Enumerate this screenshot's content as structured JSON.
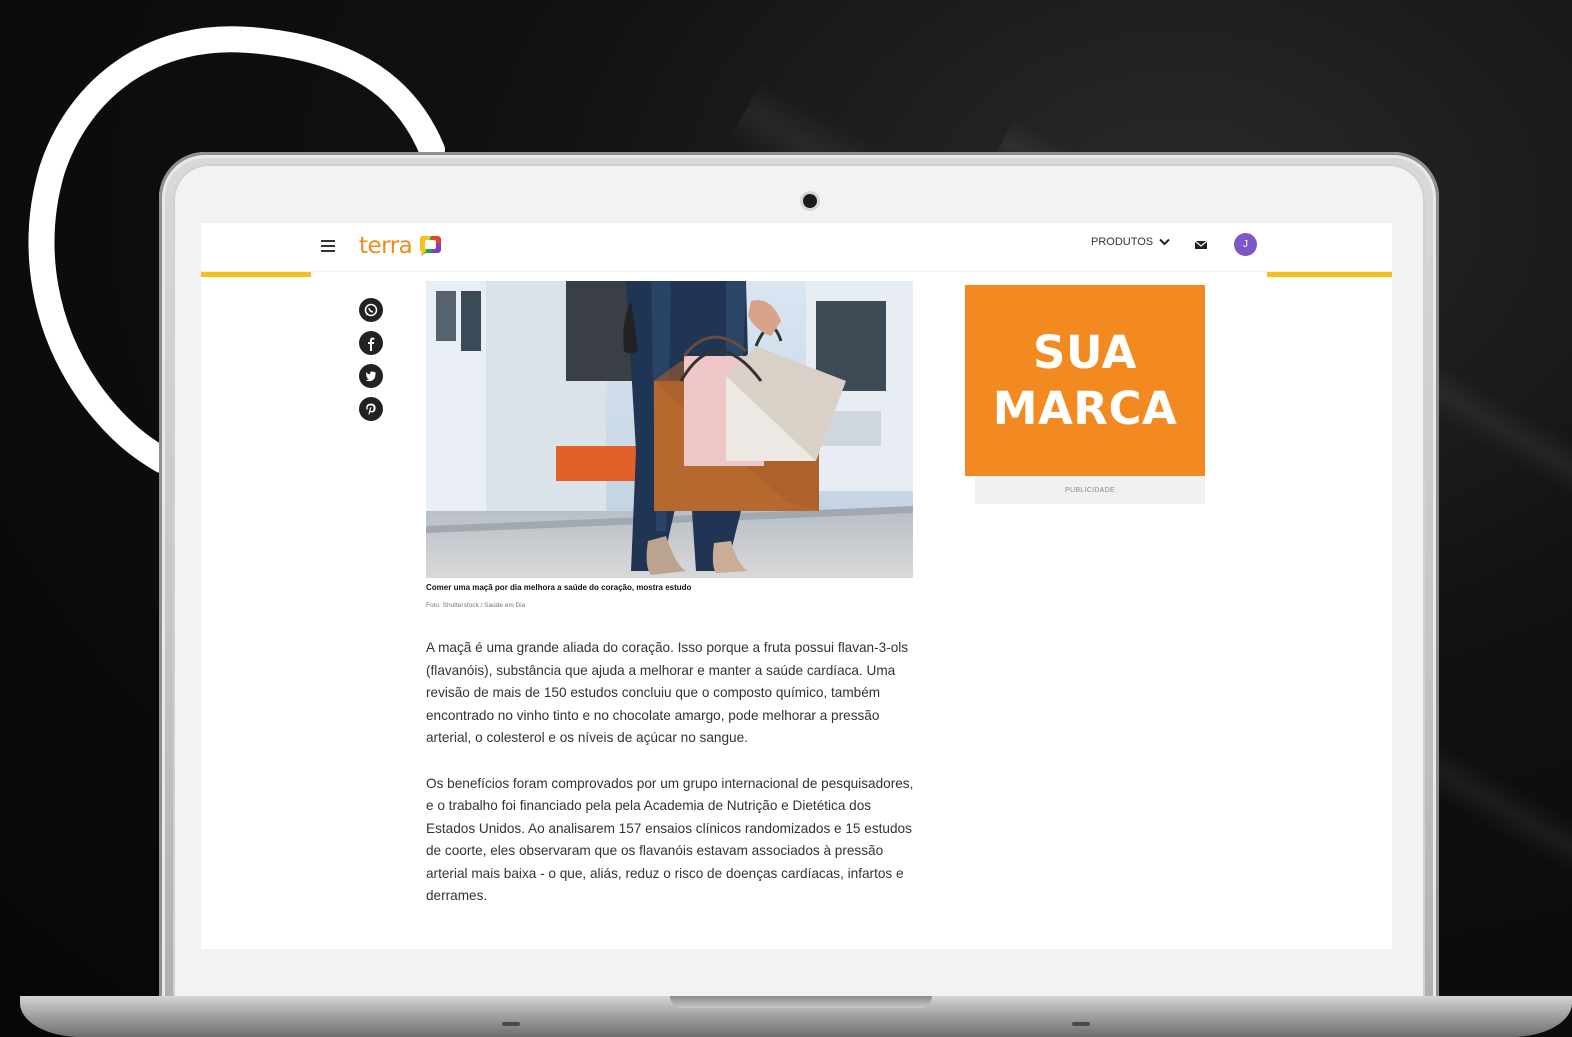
{
  "site": {
    "logo_text": "terra",
    "nav_products": "PRODUTOS",
    "user_initial": "J"
  },
  "icons": {
    "menu": "hamburger-icon",
    "products_toggle": "chevron-down-icon",
    "mail": "envelope-icon",
    "share": [
      "whatsapp-icon",
      "facebook-icon",
      "twitter-icon",
      "pinterest-icon"
    ]
  },
  "article": {
    "image_caption": "Comer uma maçã por dia melhora a saúde do coração, mostra estudo",
    "image_credit": "Foto: Shutterstock / Saúde em Dia",
    "paragraphs": [
      "A maçã é uma grande aliada do coração. Isso porque a fruta possui flavan-3-ols (flavanóis), substância que ajuda a melhorar e manter a saúde cardíaca. Uma revisão de mais de 150 estudos concluiu que o composto químico, também encontrado no vinho tinto e no chocolate amargo, pode melhorar a pressão arterial, o colesterol e os níveis de açúcar no sangue.",
      "Os benefícios foram comprovados por um grupo internacional de pesquisadores, e o trabalho foi financiado pela pela Academia de Nutrição e Dietética dos Estados Unidos. Ao analisarem 157 ensaios clínicos randomizados e 15 estudos de coorte, eles observaram que os flavanóis estavam associados à pressão arterial mais baixa - o que, aliás, reduz o risco de doenças cardíacas, infartos e derrames."
    ]
  },
  "ad": {
    "line1": "SUA",
    "line2": "MARCA",
    "label": "PUBLICIDADE"
  },
  "colors": {
    "accent_yellow": "#f5c21b",
    "brand_orange": "#f18a1b",
    "ad_orange": "#f28a21",
    "avatar_purple": "#7b57c7"
  }
}
